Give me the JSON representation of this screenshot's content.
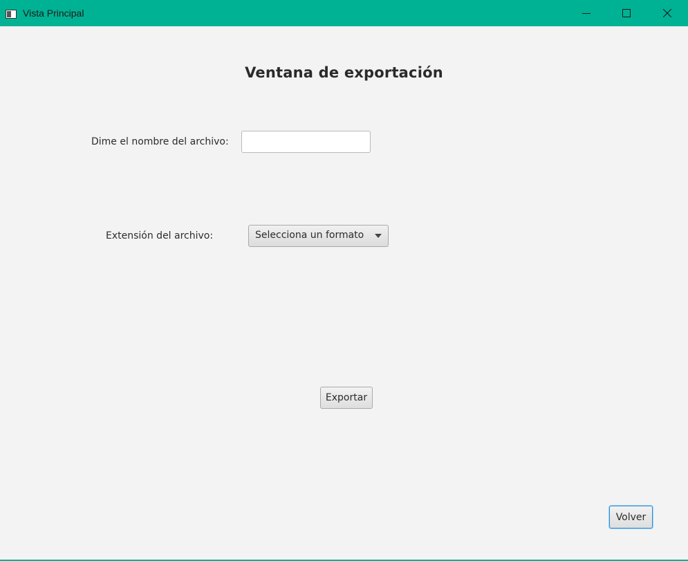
{
  "window": {
    "title": "Vista Principal",
    "icon": "app-window-icon",
    "controls": {
      "minimize_icon": "minimize-icon",
      "maximize_icon": "maximize-icon",
      "close_icon": "close-icon"
    },
    "accent_color": "#00b294"
  },
  "main": {
    "heading": "Ventana de exportación",
    "filename": {
      "label": "Dime el nombre del archivo:",
      "value": "",
      "placeholder": ""
    },
    "extension": {
      "label": "Extensión del archivo:",
      "selected": "Selecciona un formato",
      "arrow_icon": "chevron-down-icon"
    },
    "export_button": "Exportar",
    "back_button": "Volver"
  }
}
